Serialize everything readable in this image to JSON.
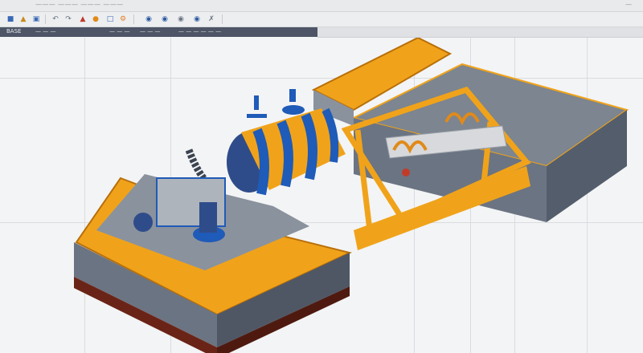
{
  "titlebar": {
    "left_text": "——— ——— ——— ———",
    "right_text": "—"
  },
  "toolbar": {
    "icons": [
      "new-file-icon",
      "open-folder-icon",
      "save-icon",
      "undo-icon",
      "redo-icon",
      "measure-icon",
      "palette-icon",
      "paste-icon",
      "settings-icon",
      "globe-icon",
      "layers-icon",
      "view-icon",
      "render-icon",
      "export-icon"
    ]
  },
  "ribbon": {
    "tabs": [
      "BASE",
      "— — —",
      "— — —",
      "— — —",
      "— — — — — —"
    ]
  },
  "colors": {
    "accent_orange": "#f0a31a",
    "accent_blue": "#1f5bb8",
    "steel_gray": "#6b7482",
    "dark_red": "#6a2417"
  }
}
